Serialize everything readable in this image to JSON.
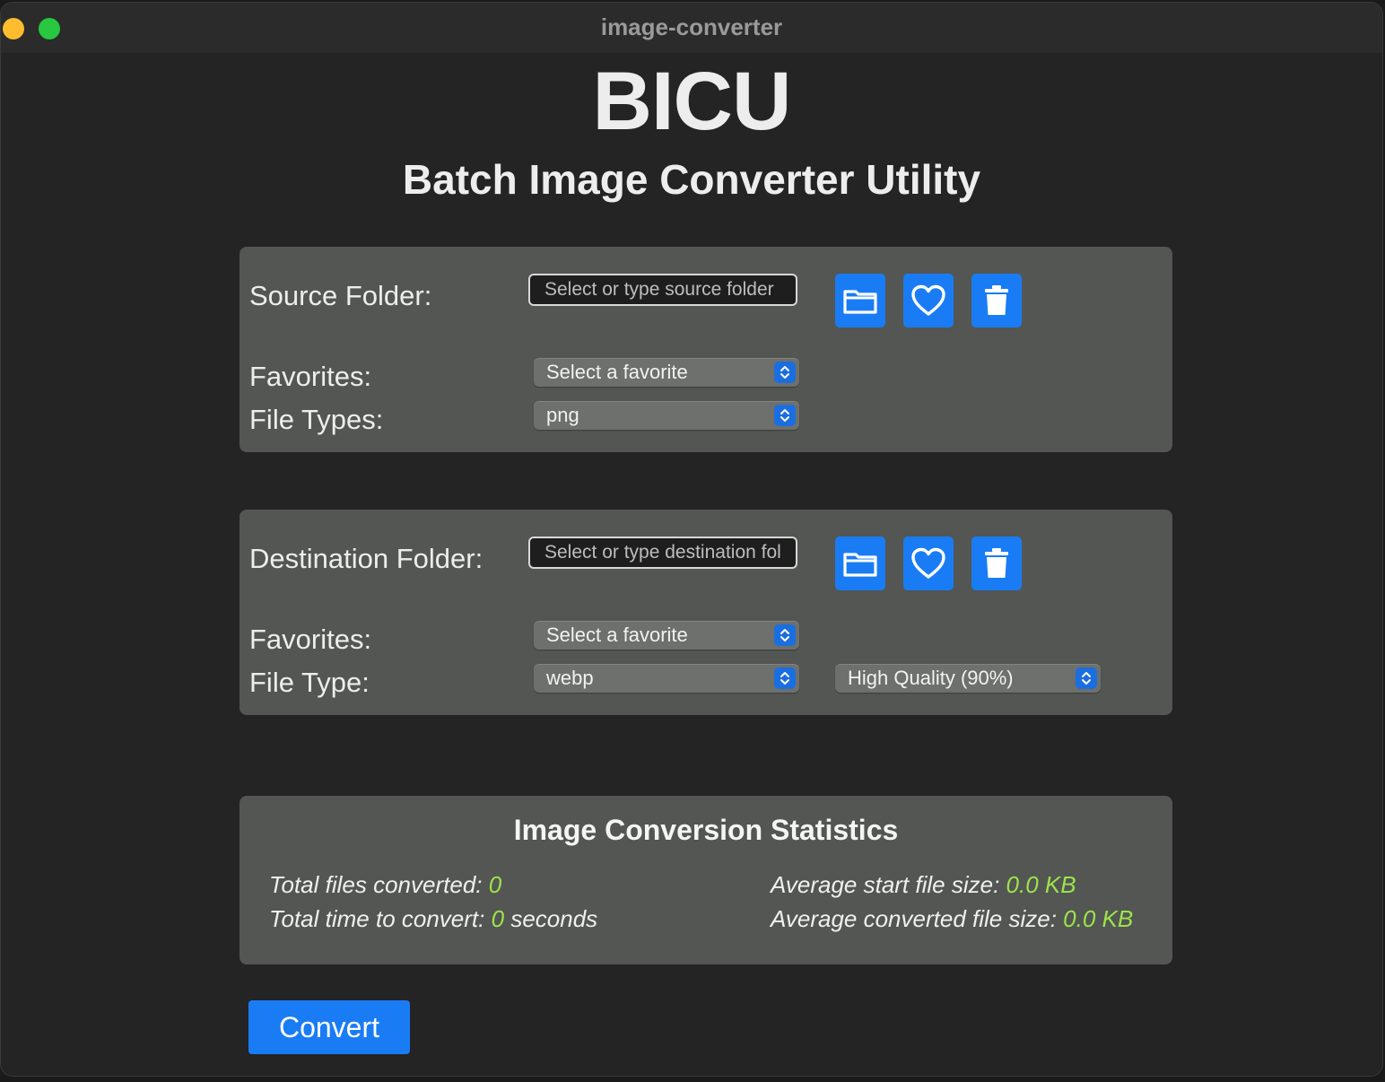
{
  "window": {
    "title": "image-converter"
  },
  "header": {
    "title": "BICU",
    "subtitle": "Batch Image Converter Utility"
  },
  "source": {
    "folder_label": "Source Folder:",
    "folder_placeholder": "Select or type source folder",
    "folder_value": "",
    "favorites_label": "Favorites:",
    "favorites_selected": "Select a favorite",
    "filetypes_label": "File Types:",
    "filetypes_selected": "png",
    "buttons": [
      "folder-icon",
      "heart-icon",
      "trash-icon"
    ]
  },
  "destination": {
    "folder_label": "Destination Folder:",
    "folder_placeholder": "Select or type destination folder",
    "folder_value": "",
    "favorites_label": "Favorites:",
    "favorites_selected": "Select a favorite",
    "filetype_label": "File Type:",
    "filetype_selected": "webp",
    "quality_selected": "High Quality (90%)",
    "buttons": [
      "folder-icon",
      "heart-icon",
      "trash-icon"
    ]
  },
  "stats": {
    "title": "Image Conversion Statistics",
    "total_files_label": "Total files converted:",
    "total_files_value": "0",
    "total_time_label": "Total time to convert:",
    "total_time_value": "0",
    "total_time_unit": "seconds",
    "avg_start_label": "Average start file size:",
    "avg_start_value": "0.0 KB",
    "avg_converted_label": "Average converted file size:",
    "avg_converted_value": "0.0 KB"
  },
  "actions": {
    "convert_label": "Convert"
  },
  "colors": {
    "accent": "#1a7cf5",
    "panel": "#535653",
    "background": "#242424",
    "stat_value": "#9be34b"
  }
}
